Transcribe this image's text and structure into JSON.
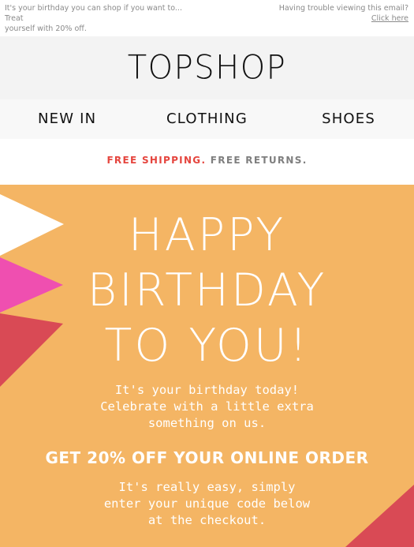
{
  "preheader": {
    "left_line1": "It's your birthday you can shop if you want to... Treat",
    "left_line2": "yourself with 20% off.",
    "right_line1": "Having trouble viewing this email?",
    "right_link": "Click here"
  },
  "brand": {
    "logo": "TOPSHOP"
  },
  "nav": {
    "new_in": "NEW IN",
    "clothing": "CLOTHING",
    "shoes": "SHOES"
  },
  "shipping": {
    "free_shipping": "FREE SHIPPING.",
    "free_returns": "FREE RETURNS."
  },
  "hero": {
    "title_line1": "HAPPY",
    "title_line2": "BIRTHDAY",
    "title_line3": "TO YOU!",
    "body_line1": "It's your birthday today!",
    "body_line2": "Celebrate with a little extra",
    "body_line3": "something on us.",
    "offer": "GET 20% OFF YOUR ONLINE ORDER",
    "code_line1": "It's really easy, simply",
    "code_line2": "enter your unique code below",
    "code_line3": "at the checkout."
  },
  "colors": {
    "hero_bg": "#f4b564",
    "shipping_accent": "#e5453e",
    "flag_white": "#ffffff",
    "flag_pink": "#ef4fb0",
    "flag_red": "#d94a55"
  }
}
